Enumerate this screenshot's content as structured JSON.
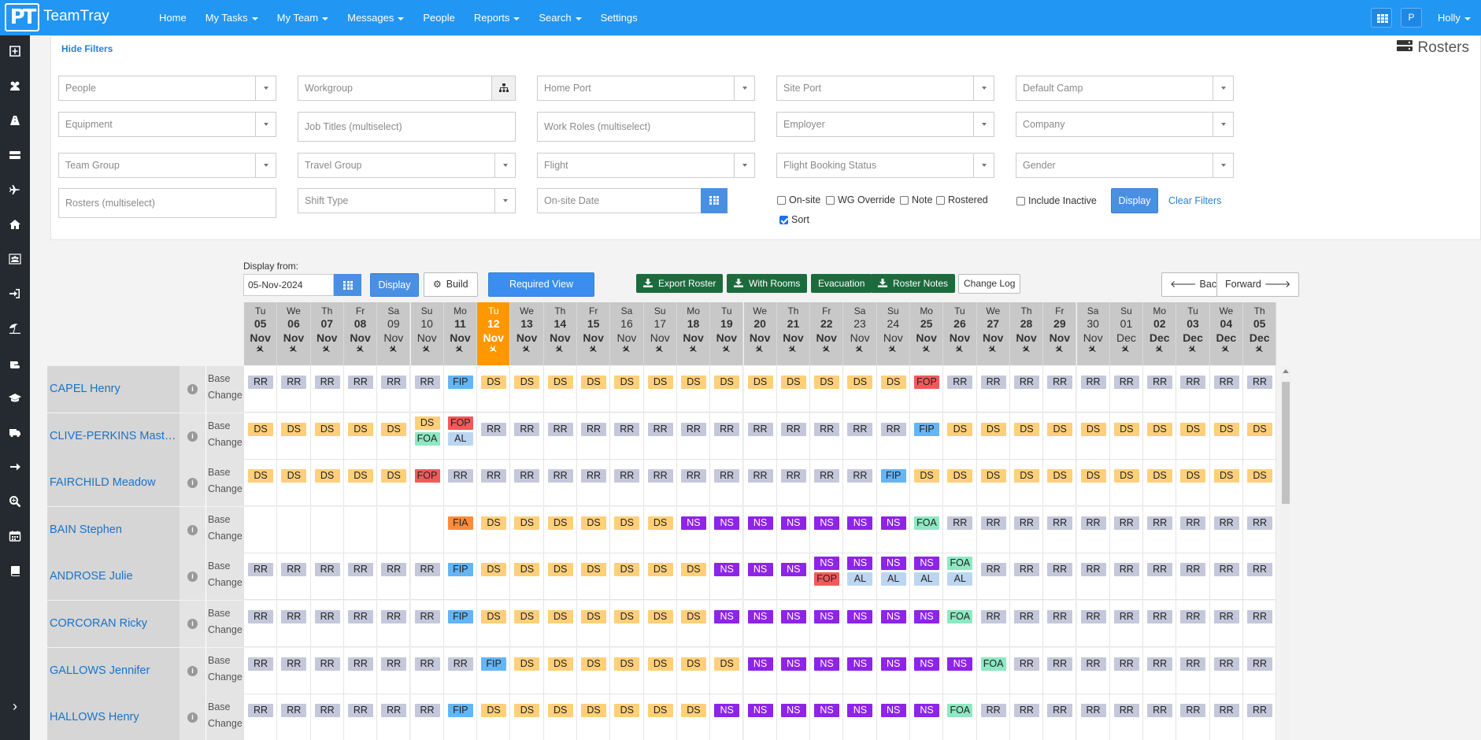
{
  "app": {
    "brand": "TeamTray",
    "logo": "PT",
    "accent": "#2196f3"
  },
  "nav": [
    {
      "label": "Home",
      "dropdown": false
    },
    {
      "label": "My Tasks",
      "dropdown": true
    },
    {
      "label": "My Team",
      "dropdown": true
    },
    {
      "label": "Messages",
      "dropdown": true
    },
    {
      "label": "People",
      "dropdown": false
    },
    {
      "label": "Reports",
      "dropdown": true
    },
    {
      "label": "Search",
      "dropdown": true
    },
    {
      "label": "Settings",
      "dropdown": false
    }
  ],
  "topbar_right": {
    "p_label": "P",
    "user": "Holly"
  },
  "sidebar_icons": [
    "plus-square-icon",
    "users-icon",
    "road-icon",
    "server-icon",
    "plane-icon",
    "home-icon",
    "people-group-icon",
    "sign-in-icon",
    "beach-umbrella-icon",
    "hand-icon",
    "graduation-cap-icon",
    "truck-icon",
    "arrow-right-icon",
    "search-plus-icon",
    "calendar-icon",
    "book-icon"
  ],
  "filters": {
    "hide_label": "Hide Filters",
    "page_title": "Rosters",
    "people": "People",
    "workgroup": "Workgroup",
    "home_port": "Home Port",
    "site_port": "Site Port",
    "default_camp": "Default Camp",
    "equipment": "Equipment",
    "job_titles": "Job Titles (multiselect)",
    "work_roles": "Work Roles (multiselect)",
    "employer": "Employer",
    "company": "Company",
    "team_group": "Team Group",
    "travel_group": "Travel Group",
    "flight": "Flight",
    "flight_booking_status": "Flight Booking Status",
    "gender": "Gender",
    "rosters": "Rosters (multiselect)",
    "shift_type": "Shift Type",
    "onsite_date": "On-site Date",
    "checks": {
      "onsite": "On-site",
      "wg_override": "WG Override",
      "note": "Note",
      "rostered": "Rostered",
      "include_inactive": "Include Inactive",
      "sort": "Sort"
    },
    "display_btn": "Display",
    "clear_filters": "Clear Filters"
  },
  "toolbar": {
    "display_from_label": "Display from:",
    "date_value": "05-Nov-2024",
    "display_btn": "Display",
    "build_btn": "Build",
    "required_view_btn": "Required View",
    "export_roster": "Export Roster",
    "with_rooms": "With Rooms",
    "evacuation": "Evacuation",
    "roster_notes": "Roster Notes",
    "change_log": "Change Log",
    "back": "Back",
    "forward": "Forward"
  },
  "days": [
    {
      "dow": "Tu",
      "d": "05",
      "m": "Nov",
      "we": false
    },
    {
      "dow": "We",
      "d": "06",
      "m": "Nov",
      "we": false
    },
    {
      "dow": "Th",
      "d": "07",
      "m": "Nov",
      "we": false
    },
    {
      "dow": "Fr",
      "d": "08",
      "m": "Nov",
      "we": false
    },
    {
      "dow": "Sa",
      "d": "09",
      "m": "Nov",
      "we": true
    },
    {
      "dow": "Su",
      "d": "10",
      "m": "Nov",
      "we": true
    },
    {
      "dow": "Mo",
      "d": "11",
      "m": "Nov",
      "we": false
    },
    {
      "dow": "Tu",
      "d": "12",
      "m": "Nov",
      "we": true,
      "today": true
    },
    {
      "dow": "We",
      "d": "13",
      "m": "Nov",
      "we": false
    },
    {
      "dow": "Th",
      "d": "14",
      "m": "Nov",
      "we": false
    },
    {
      "dow": "Fr",
      "d": "15",
      "m": "Nov",
      "we": false
    },
    {
      "dow": "Sa",
      "d": "16",
      "m": "Nov",
      "we": true
    },
    {
      "dow": "Su",
      "d": "17",
      "m": "Nov",
      "we": true
    },
    {
      "dow": "Mo",
      "d": "18",
      "m": "Nov",
      "we": false
    },
    {
      "dow": "Tu",
      "d": "19",
      "m": "Nov",
      "we": false
    },
    {
      "dow": "We",
      "d": "20",
      "m": "Nov",
      "we": false
    },
    {
      "dow": "Th",
      "d": "21",
      "m": "Nov",
      "we": false
    },
    {
      "dow": "Fr",
      "d": "22",
      "m": "Nov",
      "we": false
    },
    {
      "dow": "Sa",
      "d": "23",
      "m": "Nov",
      "we": true
    },
    {
      "dow": "Su",
      "d": "24",
      "m": "Nov",
      "we": true
    },
    {
      "dow": "Mo",
      "d": "25",
      "m": "Nov",
      "we": false
    },
    {
      "dow": "Tu",
      "d": "26",
      "m": "Nov",
      "we": false
    },
    {
      "dow": "We",
      "d": "27",
      "m": "Nov",
      "we": false
    },
    {
      "dow": "Th",
      "d": "28",
      "m": "Nov",
      "we": false
    },
    {
      "dow": "Fr",
      "d": "29",
      "m": "Nov",
      "we": false
    },
    {
      "dow": "Sa",
      "d": "30",
      "m": "Nov",
      "we": true
    },
    {
      "dow": "Su",
      "d": "01",
      "m": "Dec",
      "we": true
    },
    {
      "dow": "Mo",
      "d": "02",
      "m": "Dec",
      "we": false
    },
    {
      "dow": "Tu",
      "d": "03",
      "m": "Dec",
      "we": false
    },
    {
      "dow": "We",
      "d": "04",
      "m": "Dec",
      "we": false
    },
    {
      "dow": "Th",
      "d": "05",
      "m": "Dec",
      "we": false
    }
  ],
  "code_colors": {
    "RR": "#c5c8da",
    "DS": "#ffcf7a",
    "NS": "#8e24e8",
    "FIP": "#64b5f6",
    "FOP": "#f25a5a",
    "FOA": "#8ee8c2",
    "AL": "#bcd6f2",
    "FIA": "#ff8c3a"
  },
  "rows": [
    {
      "name": "CAPEL Henry",
      "base": [
        "Base",
        "Change"
      ],
      "cells": [
        [
          "RR"
        ],
        [
          "RR"
        ],
        [
          "RR"
        ],
        [
          "RR"
        ],
        [
          "RR"
        ],
        [
          "RR"
        ],
        [
          "FIP"
        ],
        [
          "DS"
        ],
        [
          "DS"
        ],
        [
          "DS"
        ],
        [
          "DS"
        ],
        [
          "DS"
        ],
        [
          "DS"
        ],
        [
          "DS"
        ],
        [
          "DS"
        ],
        [
          "DS"
        ],
        [
          "DS"
        ],
        [
          "DS"
        ],
        [
          "DS"
        ],
        [
          "DS"
        ],
        [
          "FOP"
        ],
        [
          "RR"
        ],
        [
          "RR"
        ],
        [
          "RR"
        ],
        [
          "RR"
        ],
        [
          "RR"
        ],
        [
          "RR"
        ],
        [
          "RR"
        ],
        [
          "RR"
        ],
        [
          "RR"
        ],
        [
          "RR"
        ]
      ]
    },
    {
      "name": "CLIVE-PERKINS Master...",
      "base": [
        "Base",
        "Change"
      ],
      "cells": [
        [
          "DS"
        ],
        [
          "DS"
        ],
        [
          "DS"
        ],
        [
          "DS"
        ],
        [
          "DS"
        ],
        [
          "DS",
          "FOA"
        ],
        [
          "FOP",
          "AL"
        ],
        [
          "RR"
        ],
        [
          "RR"
        ],
        [
          "RR"
        ],
        [
          "RR"
        ],
        [
          "RR"
        ],
        [
          "RR"
        ],
        [
          "RR"
        ],
        [
          "RR"
        ],
        [
          "RR"
        ],
        [
          "RR"
        ],
        [
          "RR"
        ],
        [
          "RR"
        ],
        [
          "RR"
        ],
        [
          "FIP"
        ],
        [
          "DS"
        ],
        [
          "DS"
        ],
        [
          "DS"
        ],
        [
          "DS"
        ],
        [
          "DS"
        ],
        [
          "DS"
        ],
        [
          "DS"
        ],
        [
          "DS"
        ],
        [
          "DS"
        ],
        [
          "DS"
        ]
      ]
    },
    {
      "name": "FAIRCHILD Meadow",
      "base": [
        "Base",
        "Change"
      ],
      "cells": [
        [
          "DS"
        ],
        [
          "DS"
        ],
        [
          "DS"
        ],
        [
          "DS"
        ],
        [
          "DS"
        ],
        [
          "FOP"
        ],
        [
          "RR"
        ],
        [
          "RR"
        ],
        [
          "RR"
        ],
        [
          "RR"
        ],
        [
          "RR"
        ],
        [
          "RR"
        ],
        [
          "RR"
        ],
        [
          "RR"
        ],
        [
          "RR"
        ],
        [
          "RR"
        ],
        [
          "RR"
        ],
        [
          "RR"
        ],
        [
          "RR"
        ],
        [
          "FIP"
        ],
        [
          "DS"
        ],
        [
          "DS"
        ],
        [
          "DS"
        ],
        [
          "DS"
        ],
        [
          "DS"
        ],
        [
          "DS"
        ],
        [
          "DS"
        ],
        [
          "DS"
        ],
        [
          "DS"
        ],
        [
          "DS"
        ],
        [
          "DS"
        ]
      ]
    },
    {
      "name": "BAIN Stephen",
      "base": [
        "Base",
        "Change"
      ],
      "cells": [
        [],
        [],
        [],
        [],
        [],
        [],
        [
          "FIA"
        ],
        [
          "DS"
        ],
        [
          "DS"
        ],
        [
          "DS"
        ],
        [
          "DS"
        ],
        [
          "DS"
        ],
        [
          "DS"
        ],
        [
          "NS"
        ],
        [
          "NS"
        ],
        [
          "NS"
        ],
        [
          "NS"
        ],
        [
          "NS"
        ],
        [
          "NS"
        ],
        [
          "NS"
        ],
        [
          "FOA"
        ],
        [
          "RR"
        ],
        [
          "RR"
        ],
        [
          "RR"
        ],
        [
          "RR"
        ],
        [
          "RR"
        ],
        [
          "RR"
        ],
        [
          "RR"
        ],
        [
          "RR"
        ],
        [
          "RR"
        ],
        [
          "RR"
        ]
      ]
    },
    {
      "name": "ANDROSE Julie",
      "base": [
        "Base",
        "Change"
      ],
      "cells": [
        [
          "RR"
        ],
        [
          "RR"
        ],
        [
          "RR"
        ],
        [
          "RR"
        ],
        [
          "RR"
        ],
        [
          "RR"
        ],
        [
          "FIP"
        ],
        [
          "DS"
        ],
        [
          "DS"
        ],
        [
          "DS"
        ],
        [
          "DS"
        ],
        [
          "DS"
        ],
        [
          "DS"
        ],
        [
          "DS"
        ],
        [
          "NS"
        ],
        [
          "NS"
        ],
        [
          "NS"
        ],
        [
          "NS",
          "FOP"
        ],
        [
          "NS",
          "AL"
        ],
        [
          "NS",
          "AL"
        ],
        [
          "NS",
          "AL"
        ],
        [
          "FOA",
          "AL"
        ],
        [
          "RR"
        ],
        [
          "RR"
        ],
        [
          "RR"
        ],
        [
          "RR"
        ],
        [
          "RR"
        ],
        [
          "RR"
        ],
        [
          "RR"
        ],
        [
          "RR"
        ],
        [
          "RR"
        ]
      ]
    },
    {
      "name": "CORCORAN Ricky",
      "base": [
        "Base",
        "Change"
      ],
      "cells": [
        [
          "RR"
        ],
        [
          "RR"
        ],
        [
          "RR"
        ],
        [
          "RR"
        ],
        [
          "RR"
        ],
        [
          "RR"
        ],
        [
          "FIP"
        ],
        [
          "DS"
        ],
        [
          "DS"
        ],
        [
          "DS"
        ],
        [
          "DS"
        ],
        [
          "DS"
        ],
        [
          "DS"
        ],
        [
          "DS"
        ],
        [
          "NS"
        ],
        [
          "NS"
        ],
        [
          "NS"
        ],
        [
          "NS"
        ],
        [
          "NS"
        ],
        [
          "NS"
        ],
        [
          "NS"
        ],
        [
          "FOA"
        ],
        [
          "RR"
        ],
        [
          "RR"
        ],
        [
          "RR"
        ],
        [
          "RR"
        ],
        [
          "RR"
        ],
        [
          "RR"
        ],
        [
          "RR"
        ],
        [
          "RR"
        ],
        [
          "RR"
        ]
      ]
    },
    {
      "name": "GALLOWS Jennifer",
      "base": [
        "Base",
        "Change"
      ],
      "cells": [
        [
          "RR"
        ],
        [
          "RR"
        ],
        [
          "RR"
        ],
        [
          "RR"
        ],
        [
          "RR"
        ],
        [
          "RR"
        ],
        [
          "RR"
        ],
        [
          "FIP"
        ],
        [
          "DS"
        ],
        [
          "DS"
        ],
        [
          "DS"
        ],
        [
          "DS"
        ],
        [
          "DS"
        ],
        [
          "DS"
        ],
        [
          "DS"
        ],
        [
          "NS"
        ],
        [
          "NS"
        ],
        [
          "NS"
        ],
        [
          "NS"
        ],
        [
          "NS"
        ],
        [
          "NS"
        ],
        [
          "NS"
        ],
        [
          "FOA"
        ],
        [
          "RR"
        ],
        [
          "RR"
        ],
        [
          "RR"
        ],
        [
          "RR"
        ],
        [
          "RR"
        ],
        [
          "RR"
        ],
        [
          "RR"
        ],
        [
          "RR"
        ]
      ]
    },
    {
      "name": "HALLOWS Henry",
      "base": [
        "Base",
        "Change"
      ],
      "cells": [
        [
          "RR"
        ],
        [
          "RR"
        ],
        [
          "RR"
        ],
        [
          "RR"
        ],
        [
          "RR"
        ],
        [
          "RR"
        ],
        [
          "FIP"
        ],
        [
          "DS"
        ],
        [
          "DS"
        ],
        [
          "DS"
        ],
        [
          "DS"
        ],
        [
          "DS"
        ],
        [
          "DS"
        ],
        [
          "DS"
        ],
        [
          "NS"
        ],
        [
          "NS"
        ],
        [
          "NS"
        ],
        [
          "NS"
        ],
        [
          "NS"
        ],
        [
          "NS"
        ],
        [
          "NS"
        ],
        [
          "FOA"
        ],
        [
          "RR"
        ],
        [
          "RR"
        ],
        [
          "RR"
        ],
        [
          "RR"
        ],
        [
          "RR"
        ],
        [
          "RR"
        ],
        [
          "RR"
        ],
        [
          "RR"
        ],
        [
          "RR"
        ]
      ]
    }
  ]
}
